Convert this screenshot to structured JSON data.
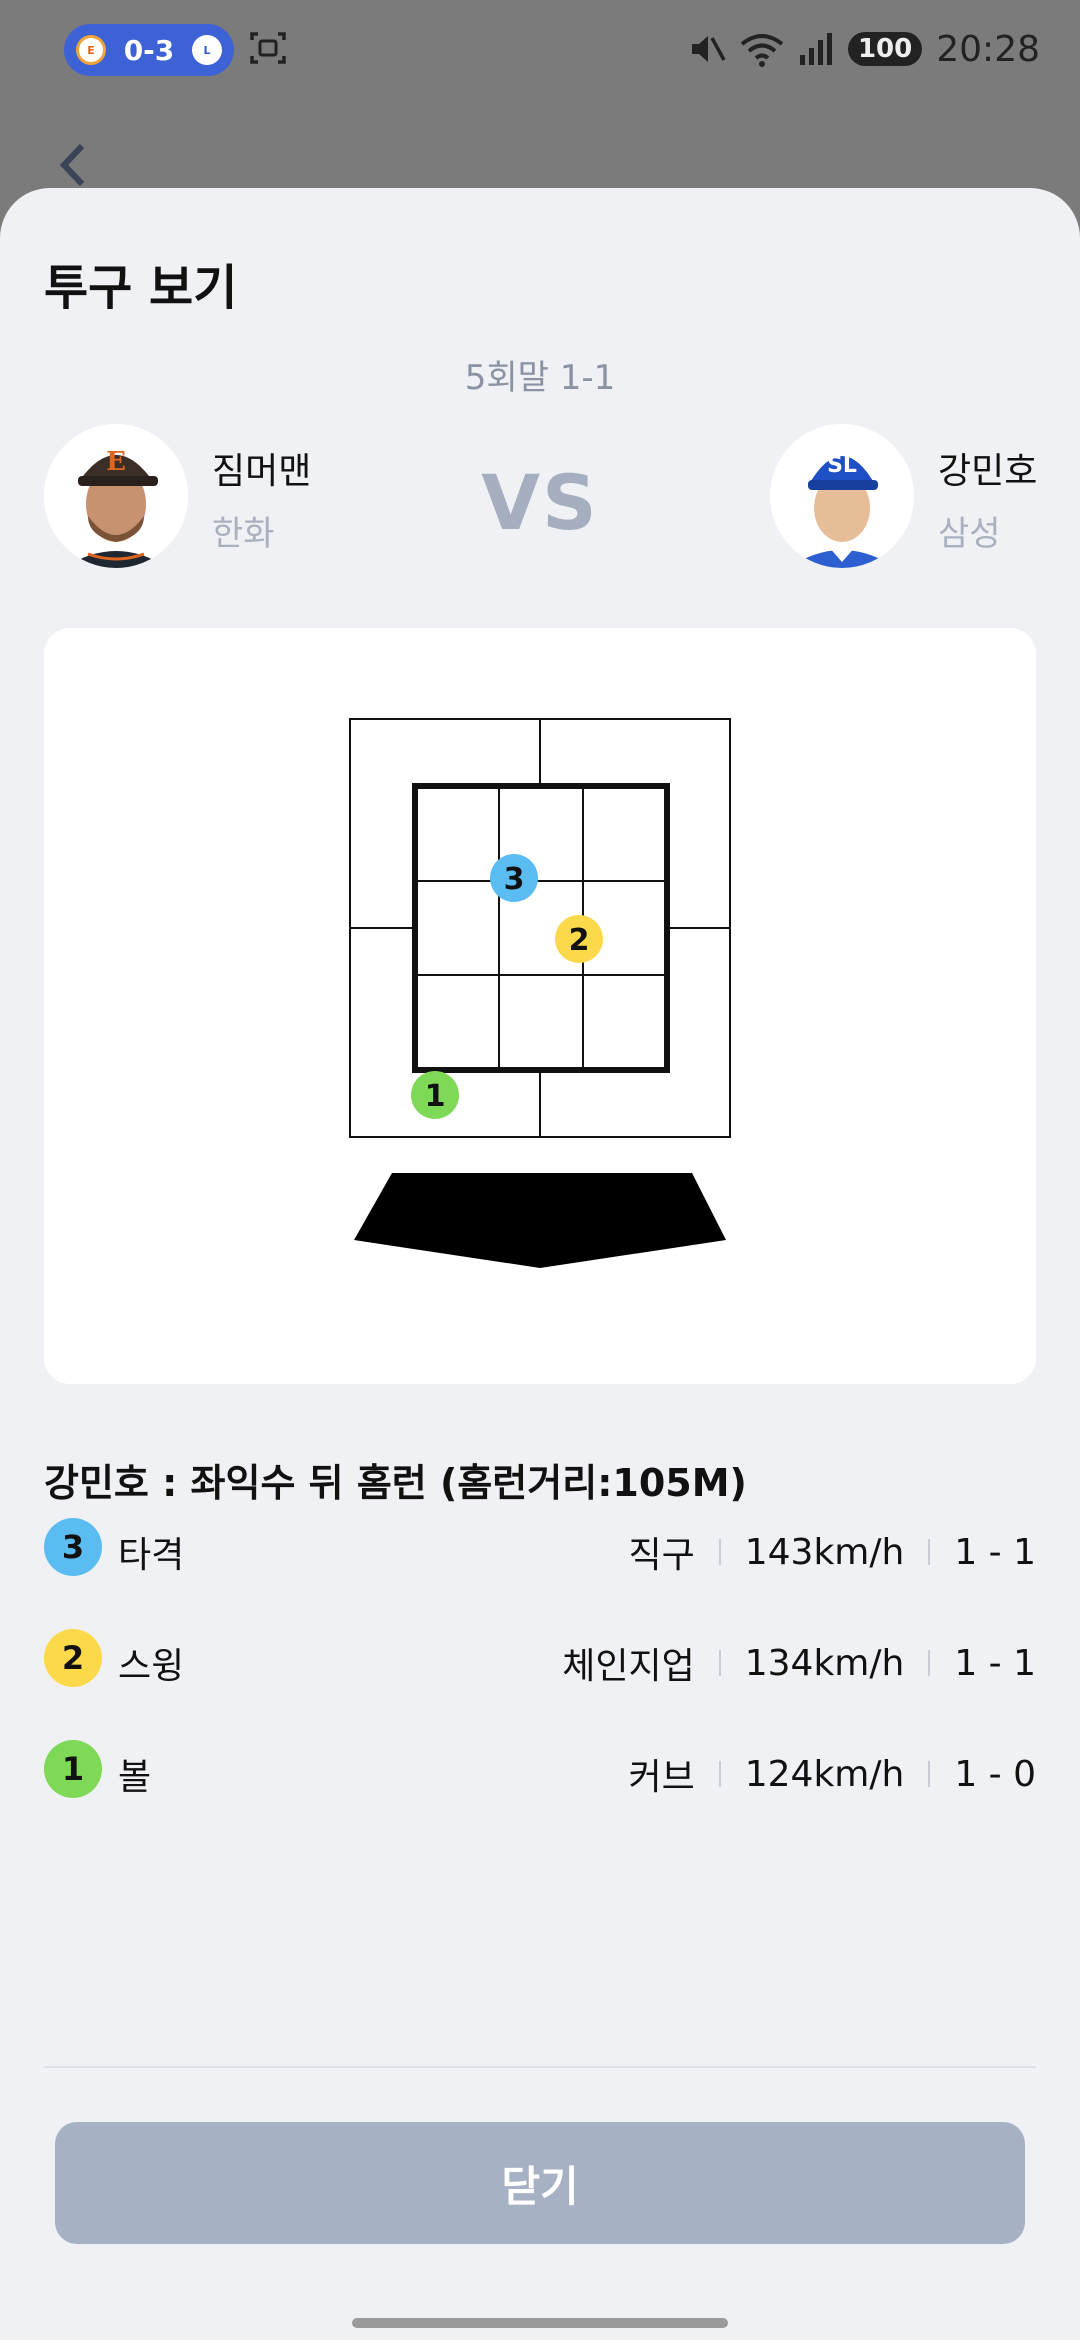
{
  "status_bar": {
    "score": "0-3",
    "battery": "100",
    "time": "20:28"
  },
  "sheet": {
    "title": "투구 보기",
    "inning": "5회말 1-1",
    "vs": "VS"
  },
  "pitcher": {
    "name": "짐머맨",
    "team": "한화"
  },
  "batter": {
    "name": "강민호",
    "team": "삼성"
  },
  "result": "강민호 : 좌익수 뒤 홈런 (홈런거리:105M)",
  "pitches": [
    {
      "number": "3",
      "label": "타격",
      "type": "직구",
      "speed": "143km/h",
      "count": "1 - 1",
      "color": "#5bbcf2"
    },
    {
      "number": "2",
      "label": "스윙",
      "type": "체인지업",
      "speed": "134km/h",
      "count": "1 - 1",
      "color": "#fcd94a"
    },
    {
      "number": "1",
      "label": "볼",
      "type": "커브",
      "speed": "124km/h",
      "count": "1 - 0",
      "color": "#7ed957"
    }
  ],
  "close_button": "닫기",
  "colors": {
    "accent_blue": "#3d62d6",
    "button_bg": "#a6b1c3",
    "sheet_bg": "#f0f1f4"
  }
}
